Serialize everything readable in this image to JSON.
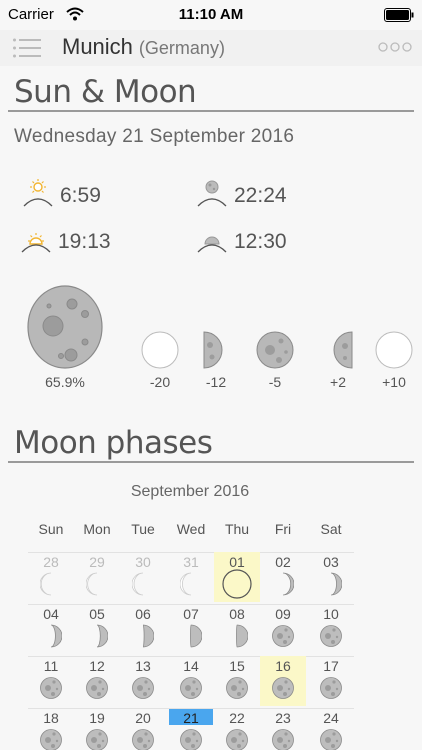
{
  "status": {
    "carrier": "Carrier",
    "time": "11:10 AM"
  },
  "nav": {
    "city": "Munich",
    "country": "(Germany)",
    "menu_icon": "list-icon",
    "more_icon": "more-dots-icon"
  },
  "sun_moon": {
    "title": "Sun & Moon",
    "date": "Wednesday 21 September 2016",
    "sunrise": "6:59",
    "moonrise": "22:24",
    "sunset": "19:13",
    "moonset": "12:30"
  },
  "illumination": {
    "current": "65.9%",
    "offsets": [
      "-20",
      "-12",
      "-5",
      "+2",
      "+10"
    ]
  },
  "moon_phases": {
    "title": "Moon phases",
    "month": "September 2016",
    "weekdays": [
      "Sun",
      "Mon",
      "Tue",
      "Wed",
      "Thu",
      "Fri",
      "Sat"
    ],
    "weeks": [
      [
        "28",
        "29",
        "30",
        "31",
        "01",
        "02",
        "03"
      ],
      [
        "04",
        "05",
        "06",
        "07",
        "08",
        "09",
        "10"
      ],
      [
        "11",
        "12",
        "13",
        "14",
        "15",
        "16",
        "17"
      ],
      [
        "18",
        "19",
        "20",
        "21",
        "22",
        "23",
        "24"
      ]
    ],
    "new_moon": "01",
    "full_moon": "16",
    "today": "21"
  },
  "colors": {
    "sun": "#f2b531",
    "moon": "#b5b5b5",
    "today": "#4aa6ee",
    "highlight": "#fbf8c8"
  }
}
